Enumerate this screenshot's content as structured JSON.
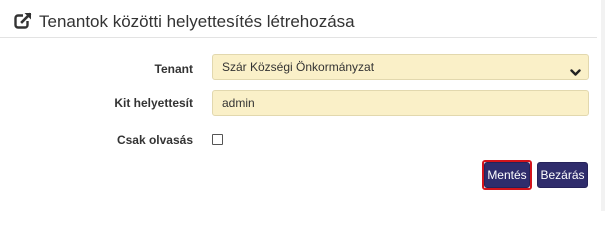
{
  "dialog": {
    "title": "Tenantok közötti helyettesítés létrehozása",
    "title_icon": "external-link-icon"
  },
  "form": {
    "tenant": {
      "label": "Tenant",
      "selected_value": "Szár Községi Önkormányzat",
      "icon": "chevron-down-icon"
    },
    "substitute": {
      "label": "Kit helyettesít",
      "value": "admin"
    },
    "read_only": {
      "label": "Csak olvasás",
      "checked": false
    }
  },
  "buttons": {
    "save_label": "Mentés",
    "close_label": "Bezárás"
  },
  "colors": {
    "field_bg": "#faf0c8",
    "button_bg": "#2f2d6c",
    "highlight_border": "#d3141b"
  }
}
